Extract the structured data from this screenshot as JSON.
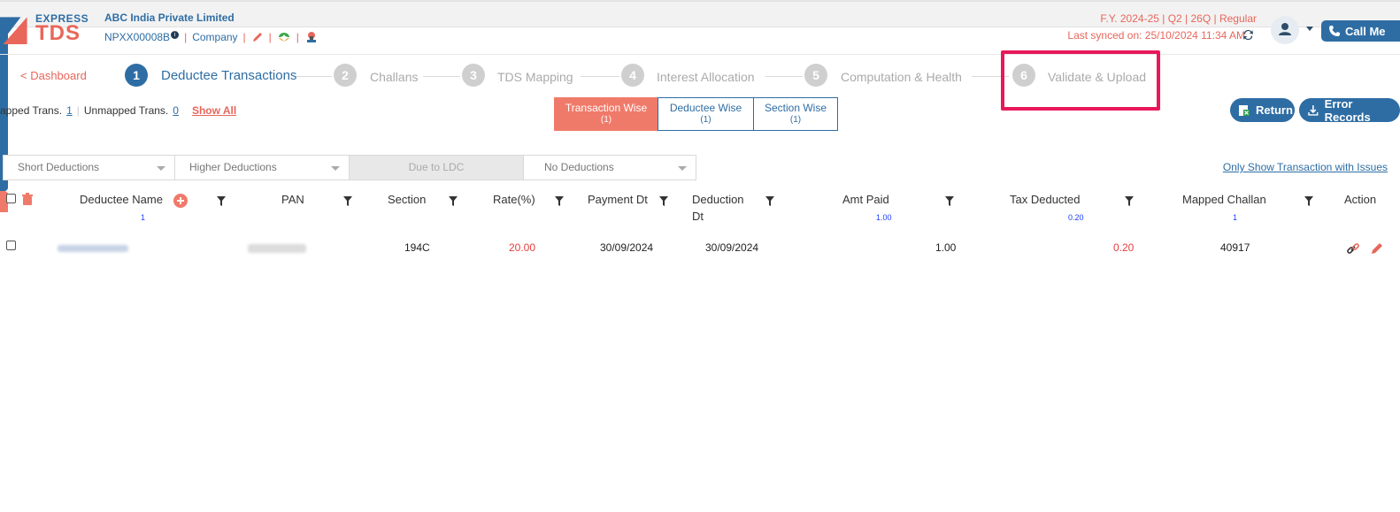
{
  "brand": {
    "logo_line1": "EXPRESS",
    "logo_line2": "TDS",
    "accent": "#e8665a",
    "primary": "#2e6da4"
  },
  "company": {
    "name": "ABC India Private Limited",
    "id": "NPXX00008B",
    "type": "Company"
  },
  "header": {
    "period": "F.Y. 2024-25  | Q2  | 26Q | Regular",
    "last_synced": "Last synced on: 25/10/2024 11:34 AM",
    "call_label": "Call Me"
  },
  "stepper": {
    "back": "< Dashboard",
    "steps": [
      {
        "num": "1",
        "label": "Deductee Transactions"
      },
      {
        "num": "2",
        "label": "Challans"
      },
      {
        "num": "3",
        "label": "TDS Mapping"
      },
      {
        "num": "4",
        "label": "Interest Allocation"
      },
      {
        "num": "5",
        "label": "Computation & Health"
      },
      {
        "num": "6",
        "label": "Validate & Upload"
      }
    ]
  },
  "summary": {
    "mapped_label": "apped Trans.",
    "mapped_count": "1",
    "unmapped_label": "Unmapped Trans.",
    "unmapped_count": "0",
    "show_all": "Show All"
  },
  "view_tabs": [
    {
      "label": "Transaction Wise",
      "count": "(1)"
    },
    {
      "label": "Deductee Wise",
      "count": "(1)"
    },
    {
      "label": "Section Wise",
      "count": "(1)"
    }
  ],
  "actions": {
    "return": "Return",
    "error_records": "Error Records"
  },
  "filters": {
    "short": "Short Deductions",
    "higher": "Higher Deductions",
    "ldc": "Due to LDC",
    "none": "No Deductions",
    "only_issues": "Only Show Transaction with Issues"
  },
  "table": {
    "headers": {
      "deductee_name": "Deductee Name",
      "deductee_name_sub": "1",
      "pan": "PAN",
      "section": "Section",
      "rate": "Rate(%)",
      "payment_dt": "Payment Dt",
      "deduction_dt_1": "Deduction",
      "deduction_dt_2": "Dt",
      "amt_paid": "Amt Paid",
      "amt_paid_sub": "1.00",
      "tax_deducted": "Tax Deducted",
      "tax_deducted_sub": "0.20",
      "mapped_challan": "Mapped Challan",
      "mapped_challan_sub": "1",
      "action": "Action"
    },
    "rows": [
      {
        "section": "194C",
        "rate": "20.00",
        "payment_dt": "30/09/2024",
        "deduction_dt": "30/09/2024",
        "amt_paid": "1.00",
        "tax_deducted": "0.20",
        "mapped_challan": "40917"
      }
    ]
  }
}
